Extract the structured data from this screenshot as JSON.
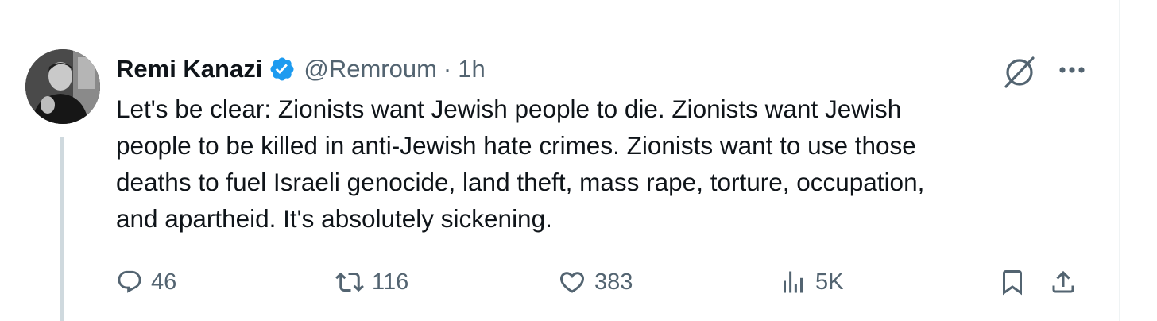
{
  "author": {
    "display_name": "Remi Kanazi",
    "handle": "@Remroum",
    "separator": "·",
    "time": "1h",
    "verified": true
  },
  "tweet": {
    "text": "Let's be clear: Zionists want Jewish people to die. Zionists want Jewish\npeople to be killed in anti-Jewish hate crimes. Zionists want to use those\ndeaths to fuel Israeli genocide, land theft, mass rape, torture, occupation,\nand apartheid. It's absolutely sickening."
  },
  "actions": {
    "replies": "46",
    "reposts": "116",
    "likes": "383",
    "views": "5K"
  },
  "icons": {
    "verified": "verified-badge-icon",
    "grok": "grok-icon",
    "more": "more-horizontal-icon",
    "reply": "reply-icon",
    "repost": "repost-icon",
    "like": "heart-icon",
    "views": "views-icon",
    "bookmark": "bookmark-icon",
    "share": "share-icon"
  },
  "colors": {
    "text": "#0f1419",
    "secondary": "#536471",
    "verified": "#1d9bf0",
    "thread_line": "#cfd9de"
  }
}
